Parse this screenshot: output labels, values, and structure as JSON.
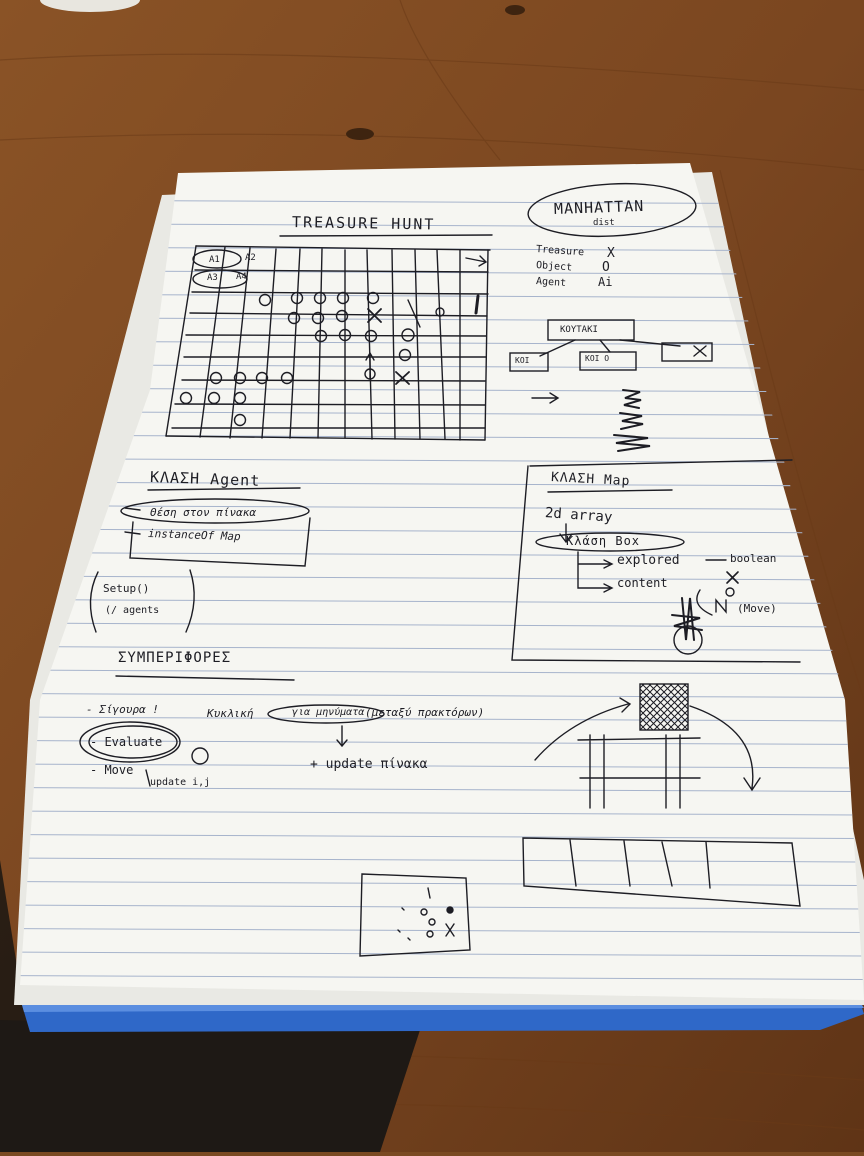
{
  "sketch": {
    "title": "TREASURE HUNT",
    "manhattan": "MANHATTAN",
    "manhattan_sub": "dist",
    "legend": [
      {
        "label": "Treasure",
        "symbol": "X"
      },
      {
        "label": "Object",
        "symbol": "O"
      },
      {
        "label": "Agent",
        "symbol": "Ai"
      }
    ],
    "agent_cells": [
      "A1",
      "A2",
      "A3",
      "A4"
    ],
    "tree_root": "ΚΟΥΤΑΚΙ",
    "tree_left": "ΚΟΙ",
    "tree_mid": "ΚΟΙ O",
    "agent_class": {
      "heading": "ΚΛΑΣΗ Agent",
      "items": [
        "Θέση στον πίνακα",
        "instanceOf Map"
      ]
    },
    "setup": [
      "Setup()",
      "(/ agents"
    ],
    "map_class": {
      "heading": "ΚΛΑΣΗ Map",
      "array": "2d array",
      "box": "Κλάση Box",
      "explored": "explored",
      "boolean": "boolean",
      "content": "content",
      "move": "(Move)"
    },
    "behaviours": {
      "heading": "ΣΥΜΠΕΡΙΦΟΡΕΣ",
      "line1": [
        "- Σίγουρα !",
        "Κυκλική",
        "για μηνύματα",
        "(μεταξύ πρακτόρων)"
      ],
      "evaluate": "- Evaluate",
      "move": "- Move",
      "update_small": "update i,j",
      "update_big": "+ update πίνακα"
    }
  },
  "colors": {
    "table": "#7a4a22",
    "paper": "#f6f6f2",
    "rule": "#a7b4cc",
    "ink": "#1d1d24",
    "folder": "#2f68c8"
  }
}
